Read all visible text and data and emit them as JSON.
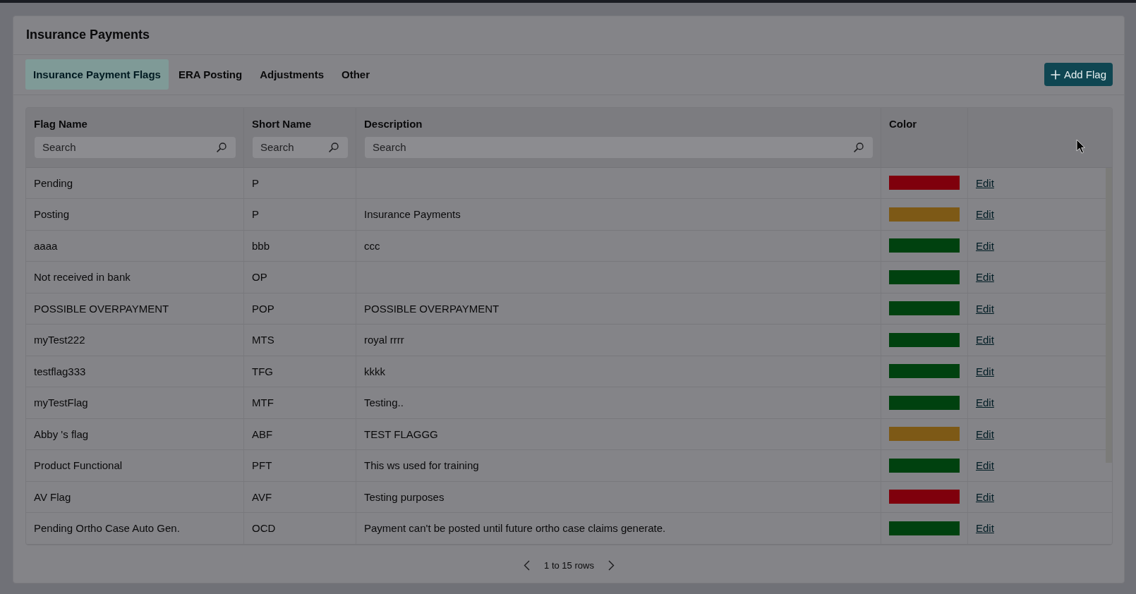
{
  "page": {
    "title": "Insurance Payments"
  },
  "tabs": [
    {
      "label": "Insurance Payment Flags",
      "selected": true
    },
    {
      "label": "ERA Posting",
      "selected": false
    },
    {
      "label": "Adjustments",
      "selected": false
    },
    {
      "label": "Other",
      "selected": false
    }
  ],
  "add_button": {
    "label": "Add Flag"
  },
  "table": {
    "columns": [
      {
        "heading": "Flag Name",
        "search": {
          "placeholder": "Search"
        }
      },
      {
        "heading": "Short Name",
        "search": {
          "placeholder": "Search"
        }
      },
      {
        "heading": "Description",
        "search": {
          "placeholder": "Search"
        }
      },
      {
        "heading": "Color"
      }
    ],
    "rows": [
      {
        "flag_name": "Pending",
        "short_name": "P",
        "color": "#7f000c",
        "action": "Edit"
      },
      {
        "flag_name": "Posting",
        "short_name": "P",
        "description": "Insurance Payments",
        "color": "#7d5916",
        "action": "Edit"
      },
      {
        "flag_name": "aaaa",
        "short_name": "bbb",
        "description": "ccc",
        "color": "#00410f",
        "action": "Edit"
      },
      {
        "flag_name": "Not received in bank",
        "short_name": "OP",
        "color": "#00410f",
        "action": "Edit"
      },
      {
        "flag_name": "POSSIBLE OVERPAYMENT",
        "short_name": "POP",
        "description": "POSSIBLE OVERPAYMENT",
        "color": "#00410f",
        "action": "Edit"
      },
      {
        "flag_name": "myTest222",
        "short_name": "MTS",
        "description": "royal rrrr",
        "color": "#00410f",
        "action": "Edit"
      },
      {
        "flag_name": "testflag333",
        "short_name": "TFG",
        "description": "kkkk",
        "color": "#00410f",
        "action": "Edit"
      },
      {
        "flag_name": "myTestFlag",
        "short_name": "MTF",
        "description": "Testing..",
        "color": "#00410f",
        "action": "Edit"
      },
      {
        "flag_name": "Abby 's flag",
        "short_name": "ABF",
        "description": "TEST FLAGGG",
        "color": "#7d5916",
        "action": "Edit"
      },
      {
        "flag_name": "Product Functional",
        "short_name": "PFT",
        "description": "This ws used for training",
        "color": "#00410f",
        "action": "Edit"
      },
      {
        "flag_name": "AV Flag",
        "short_name": "AVF",
        "description": "Testing purposes",
        "color": "#7f000c",
        "action": "Edit"
      },
      {
        "flag_name": "Pending Ortho Case Auto Gen.",
        "short_name": "OCD",
        "description": "Payment can't be posted until future ortho case claims generate.",
        "color": "#00410f",
        "action": "Edit"
      }
    ]
  },
  "pagination": {
    "summary": "1 to 15 rows"
  }
}
